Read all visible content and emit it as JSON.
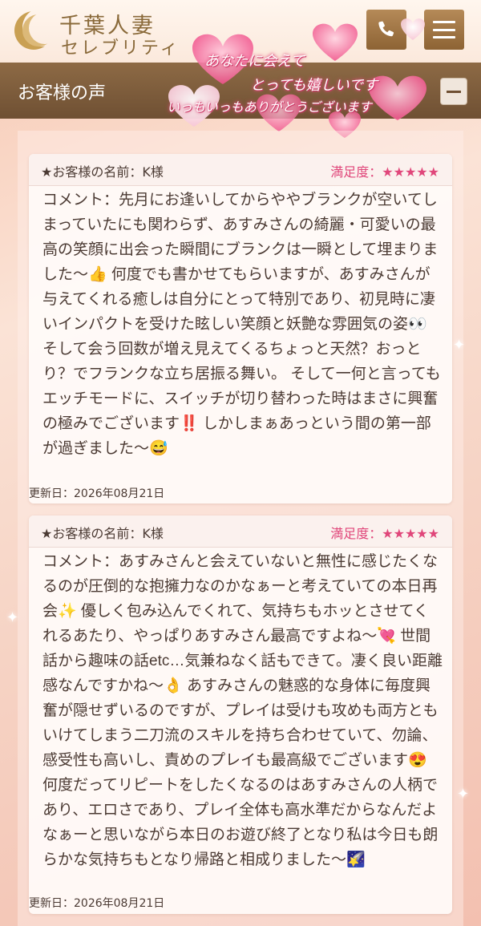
{
  "header": {
    "brand_title": "千葉人妻",
    "brand_sub": "セレブリティ",
    "phone_icon": "phone-icon",
    "menu_icon": "menu-icon"
  },
  "section": {
    "title": "お客様の声",
    "collapse_icon": "minus-icon"
  },
  "banner": {
    "line1": "あなたに会えて",
    "line2": "とっても嬉しいです",
    "line3": "いっもいっもありがとうございます"
  },
  "reviews": [
    {
      "name_label": "★お客様の名前：K様",
      "rating_label": "満足度：★★★★★",
      "comment": "コメント：先月にお逢いしてからややブランクが空いてしまっていたにも関わらず、あすみさんの綺麗・可愛いの最高の笑顔に出会った瞬間にブランクは一瞬として埋まりました〜👍 何度でも書かせてもらいますが、あすみさんが与えてくれる癒しは自分にとって特別であり、初見時に凄いインパクトを受けた眩しい笑顔と妖艶な雰囲気の姿👀 そして会う回数が増え見えてくるちょっと天然？おっとり？でフランクな立ち居振る舞い。 そして一何と言ってもエッチモードに、スイッチが切り替わった時はまさに興奮の極みでございます‼️ しかしまぁあっという間の第一部が過ぎました〜😅",
      "updated": "更新日：2026年08月21日"
    },
    {
      "name_label": "★お客様の名前：K様",
      "rating_label": "満足度：★★★★★",
      "comment": "コメント：あすみさんと会えていないと無性に感じたくなるのが圧倒的な抱擁力なのかなぁーと考えていての本日再会✨ 優しく包み込んでくれて、気持ちもホッとさせてくれるあたり、やっぱりあすみさん最高ですよね〜💘 世間話から趣味の話etc…気兼ねなく話もできて。凄く良い距離感なんですかね〜👌 あすみさんの魅惑的な身体に毎度興奮が隠せずいるのですが、プレイは受けも攻めも両方ともいけてしまう二刀流のスキルを持ち合わせていて、勿論、感受性も高いし、責めのプレイも最高級でございます😍 何度だってリピートをしたくなるのはあすみさんの人柄であり、エロさであり、プレイ全体も高水準だからなんだよなぁーと思いながら本日のお遊び終了となり私は今日も朗らかな気持ちもとなり帰路と相成りました〜🌠",
      "updated": "更新日：2026年08月21日"
    }
  ]
}
